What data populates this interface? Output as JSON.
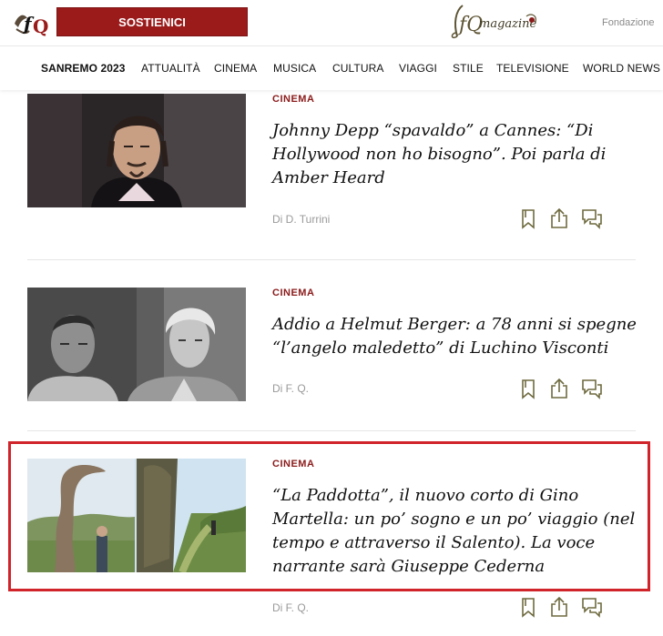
{
  "header": {
    "support_label": "SOSTIENICI",
    "fondazione_label": "Fondazione"
  },
  "nav": {
    "items": [
      "SANREMO 2023",
      "ATTUALITÀ",
      "CINEMA",
      "MUSICA",
      "CULTURA",
      "VIAGGI",
      "STILE",
      "TELEVISIONE",
      "WORLD NEWS"
    ]
  },
  "articles": [
    {
      "category": "CINEMA",
      "title": "Johnny Depp “spavaldo” a Cannes: “Di Hollywood non ho bisogno”. Poi parla di Amber Heard",
      "author": "Di D. Turrini"
    },
    {
      "category": "CINEMA",
      "title": "Addio a Helmut Berger: a 78 anni si spegne “l’angelo maledetto” di Luchino Visconti",
      "author": "Di F. Q."
    },
    {
      "category": "CINEMA",
      "title": "“La Paddotta”, il nuovo corto di Gino Martella: un po’ sogno e un po’ viaggio (nel tempo e attraverso il Salento). La voce narrante sarà Giuseppe Cederna",
      "author": "Di F. Q."
    }
  ],
  "icons": {
    "bookmark": "bookmark-icon",
    "share": "share-icon",
    "comment": "comment-icon"
  },
  "colors": {
    "brand_red": "#9b1b1b",
    "category_red": "#8b1a1a",
    "icon_olive": "#6e6a3f",
    "highlight": "#d0232a"
  }
}
